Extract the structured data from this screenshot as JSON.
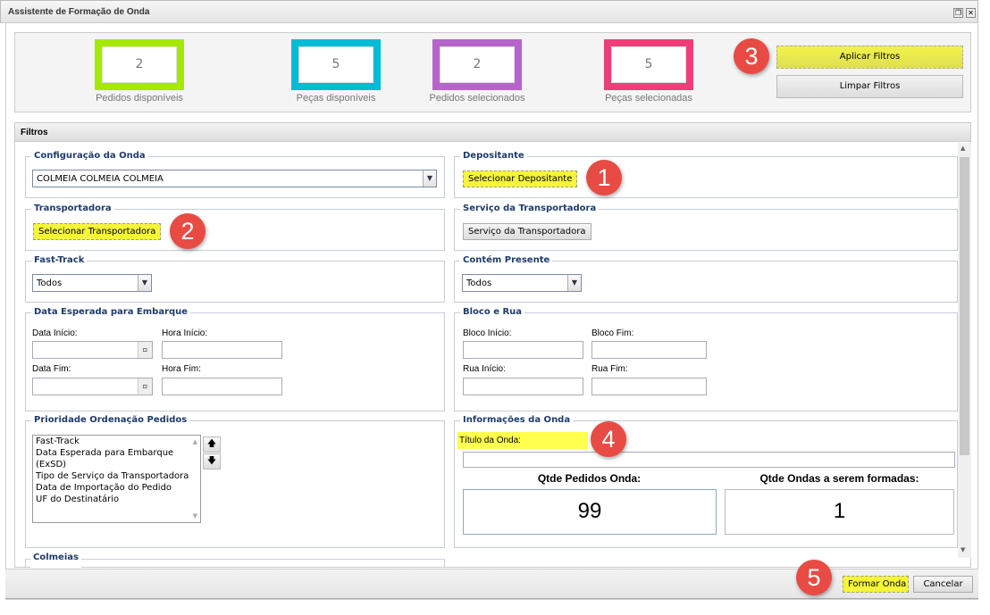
{
  "window": {
    "title": "Assistente de Formação de Onda",
    "restore_icon": "restore-icon",
    "close_icon": "close-icon"
  },
  "stats": [
    {
      "value": "2",
      "label": "Pedidos disponíveis",
      "color": "#a6e800"
    },
    {
      "value": "5",
      "label": "Peças disponíveis",
      "color": "#00bcd4"
    },
    {
      "value": "2",
      "label": "Pedidos selecionados",
      "color": "#b565c9"
    },
    {
      "value": "5",
      "label": "Peças selecionadas",
      "color": "#ee3e7a"
    }
  ],
  "actions": {
    "apply": "Aplicar Filtros",
    "clear": "Limpar Filtros"
  },
  "badges": [
    "1",
    "2",
    "3",
    "4",
    "5"
  ],
  "filters": {
    "title": "Filtros",
    "config": {
      "legend": "Configuração da Onda",
      "value": "COLMEIA COLMEIA COLMEIA"
    },
    "depositante": {
      "legend": "Depositante",
      "button": "Selecionar Depositante"
    },
    "transportadora": {
      "legend": "Transportadora",
      "button": "Selecionar Transportadora"
    },
    "servico": {
      "legend": "Serviço da Transportadora",
      "button": "Serviço da Transportadora"
    },
    "fasttrack": {
      "legend": "Fast-Track",
      "value": "Todos"
    },
    "presente": {
      "legend": "Contém Presente",
      "value": "Todos"
    },
    "data": {
      "legend": "Data Esperada para Embarque",
      "data_inicio": "Data Início:",
      "hora_inicio": "Hora Início:",
      "data_fim": "Data Fim:",
      "hora_fim": "Hora Fim:"
    },
    "bloco": {
      "legend": "Bloco e Rua",
      "bloco_inicio": "Bloco Início:",
      "bloco_fim": "Bloco Fim:",
      "rua_inicio": "Rua Início:",
      "rua_fim": "Rua Fim:"
    },
    "prioridade": {
      "legend": "Prioridade Ordenação Pedidos",
      "items": [
        "Fast-Track",
        "Data Esperada para Embarque (ExSD)",
        "Tipo de Serviço da Transportadora",
        "Data de Importação do Pedido",
        "UF do Destinatário"
      ]
    },
    "info": {
      "legend": "Informações da Onda",
      "titulo_label": "Título da Onda:",
      "titulo_value": "",
      "qtde_pedidos_label": "Qtde Pedidos Onda:",
      "qtde_pedidos": "99",
      "qtde_ondas_label": "Qtde Ondas a serem formadas:",
      "qtde_ondas": "1"
    },
    "colmeias": {
      "legend": "Colmeias"
    }
  },
  "footer": {
    "form": "Formar Onda",
    "cancel": "Cancelar"
  }
}
